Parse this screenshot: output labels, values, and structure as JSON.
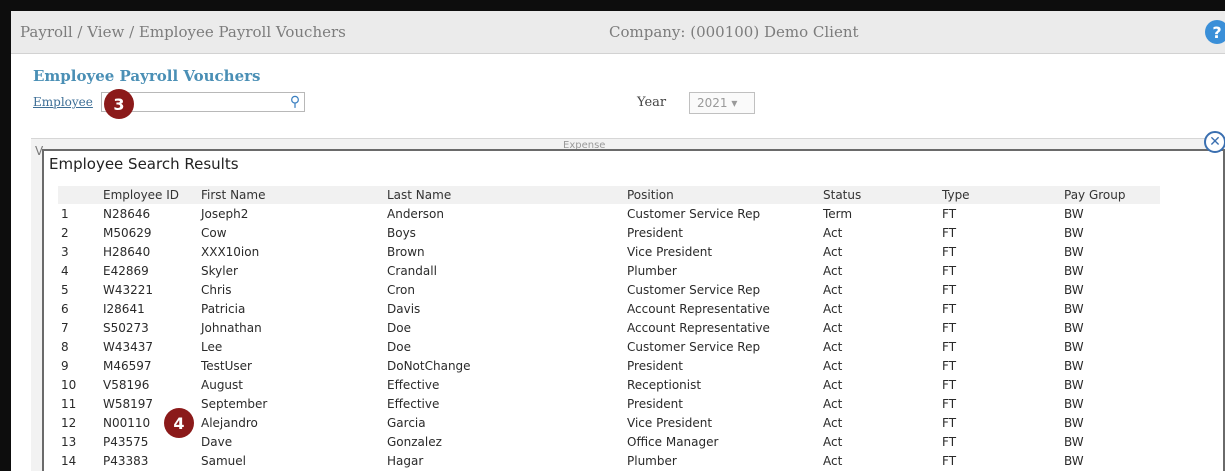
{
  "header": {
    "breadcrumb": "Payroll / View / Employee Payroll Vouchers",
    "company": "Company: (000100) Demo Client",
    "help_icon": "?"
  },
  "page": {
    "title": "Employee Payroll Vouchers",
    "employee_link": "Employee",
    "employee_value": "",
    "search_icon": "⚲",
    "year_label": "Year",
    "year_value": "2021 ▾"
  },
  "background_panel": {
    "left_fragment": "V",
    "sub_fragment": "Expense"
  },
  "callouts": {
    "badge_3": "3",
    "badge_4": "4"
  },
  "dialog": {
    "title": "Employee Search Results",
    "close_icon": "✕",
    "columns": [
      "",
      "Employee ID",
      "First Name",
      "Last Name",
      "Position",
      "Status",
      "Type",
      "Pay Group"
    ],
    "rows": [
      [
        "1",
        "N28646",
        "Joseph2",
        "Anderson",
        "Customer Service Rep",
        "Term",
        "FT",
        "BW"
      ],
      [
        "2",
        "M50629",
        "Cow",
        "Boys",
        "President",
        "Act",
        "FT",
        "BW"
      ],
      [
        "3",
        "H28640",
        "XXX10ion",
        "Brown",
        "Vice President",
        "Act",
        "FT",
        "BW"
      ],
      [
        "4",
        "E42869",
        "Skyler",
        "Crandall",
        "Plumber",
        "Act",
        "FT",
        "BW"
      ],
      [
        "5",
        "W43221",
        "Chris",
        "Cron",
        "Customer Service Rep",
        "Act",
        "FT",
        "BW"
      ],
      [
        "6",
        "I28641",
        "Patricia",
        "Davis",
        "Account Representative",
        "Act",
        "FT",
        "BW"
      ],
      [
        "7",
        "S50273",
        "Johnathan",
        "Doe",
        "Account Representative",
        "Act",
        "FT",
        "BW"
      ],
      [
        "8",
        "W43437",
        "Lee",
        "Doe",
        "Customer Service Rep",
        "Act",
        "FT",
        "BW"
      ],
      [
        "9",
        "M46597",
        "TestUser",
        "DoNotChange",
        "President",
        "Act",
        "FT",
        "BW"
      ],
      [
        "10",
        "V58196",
        "August",
        "Effective",
        "Receptionist",
        "Act",
        "FT",
        "BW"
      ],
      [
        "11",
        "W58197",
        "September",
        "Effective",
        "President",
        "Act",
        "FT",
        "BW"
      ],
      [
        "12",
        "N00110",
        "Alejandro",
        "Garcia",
        "Vice President",
        "Act",
        "FT",
        "BW"
      ],
      [
        "13",
        "P43575",
        "Dave",
        "Gonzalez",
        "Office Manager",
        "Act",
        "FT",
        "BW"
      ],
      [
        "14",
        "P43383",
        "Samuel",
        "Hagar",
        "Plumber",
        "Act",
        "FT",
        "BW"
      ]
    ]
  },
  "colors": {
    "title": "#4a8fb5",
    "badge": "#8b1a1a",
    "help": "#3a8fd8"
  }
}
